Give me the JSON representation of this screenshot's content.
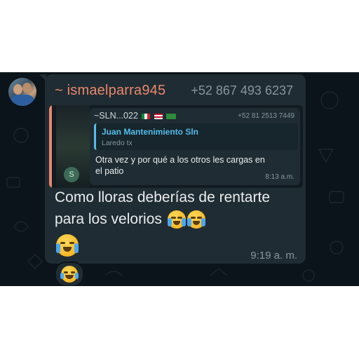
{
  "message": {
    "sender_name": "~ ismaelparra945",
    "sender_phone": "+52 867 493 6237",
    "text": "Como lloras deberías de rentarte para los velorios",
    "time": "9:19 a. m.",
    "emoji_icons": [
      "loudly-crying-face-icon",
      "loudly-crying-face-icon",
      "loudly-crying-face-icon"
    ]
  },
  "forwarded": {
    "sender": "~SLN...022",
    "sender_phone": "+52 81 2513 7449",
    "avatar_letter": "S",
    "quote": {
      "name": "Juan Mantenimiento Sln",
      "text": "Laredo tx"
    },
    "body": "Otra vez y por qué a los otros les cargas en el patio",
    "time": "8:13 a.m."
  },
  "reaction": {
    "emoji": "joy-face-icon"
  },
  "colors": {
    "chat_background": "#0b141a",
    "bubble": "#202c33",
    "sender_name": "#e9886d",
    "quote_accent": "#53bdeb",
    "timestamp": "#8696a0"
  }
}
